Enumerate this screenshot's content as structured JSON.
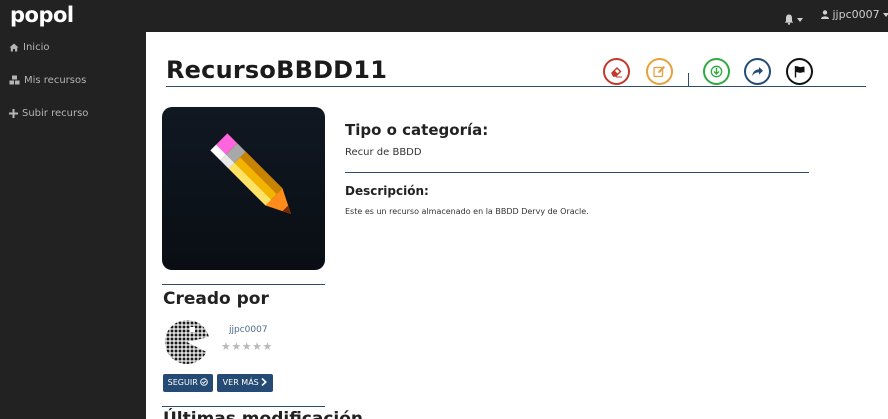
{
  "app": {
    "logo_text": "popol"
  },
  "topbar": {
    "username": "jjpc0007"
  },
  "sidebar": {
    "items": [
      {
        "label": "Inicio",
        "icon": "home-icon"
      },
      {
        "label": "Mis recursos",
        "icon": "cubes-icon"
      },
      {
        "label": "Subir recurso",
        "icon": "plus-icon"
      }
    ]
  },
  "resource": {
    "title": "RecursoBBDD11",
    "category_heading": "Tipo o categoría:",
    "category_value": "Recur de BBDD",
    "description_heading": "Descripción:",
    "description_value": "Este es un recurso almacenado en la BBDD Dervy de Oracle."
  },
  "actions": [
    {
      "name": "delete",
      "icon": "eraser-icon",
      "color": "#c0392b"
    },
    {
      "name": "edit",
      "icon": "edit-icon",
      "color": "#e8a13a"
    },
    {
      "name": "download",
      "icon": "download-icon",
      "color": "#2eaa3f"
    },
    {
      "name": "share",
      "icon": "share-icon",
      "color": "#254a73"
    },
    {
      "name": "report",
      "icon": "flag-icon",
      "color": "#111111"
    }
  ],
  "creator": {
    "heading": "Creado por",
    "username": "jjpc0007",
    "rating": "★★★★★",
    "follow_label": "SEGUIR",
    "more_label": "VER MÁS",
    "next_heading": "Últimas modificación"
  },
  "colors": {
    "topbar": "#222222",
    "accent": "#254a73",
    "rule": "#2e4d72"
  }
}
